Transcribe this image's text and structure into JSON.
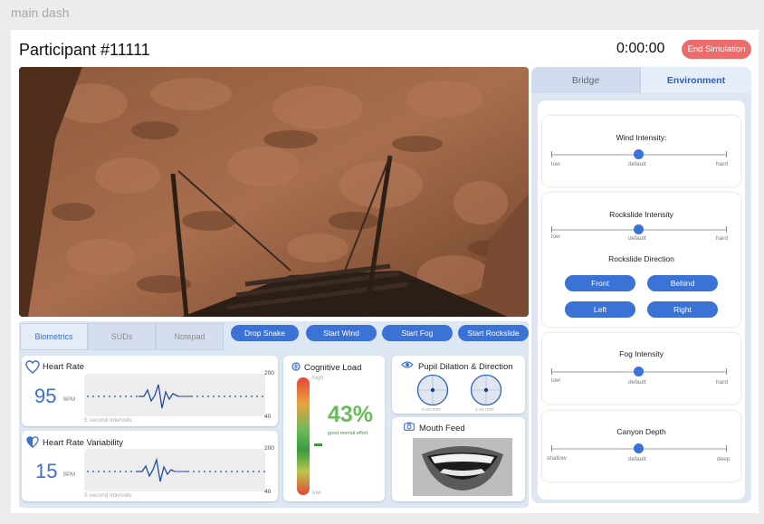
{
  "page_label": "main dash",
  "header": {
    "title": "Participant #11111",
    "timer": "0:00:00",
    "end_label": "End Simulation"
  },
  "colors": {
    "accent": "#3a72d6",
    "danger": "#ee6b6b",
    "panel": "#dde7f3",
    "success": "#6abb5a"
  },
  "video": {
    "scene": "canyon rope bridge view"
  },
  "bottom_tabs": [
    {
      "label": "Biometrics",
      "active": true
    },
    {
      "label": "SUDs",
      "active": false
    },
    {
      "label": "Notepad",
      "active": false
    }
  ],
  "actions": [
    "Drop Snake",
    "Start Wind",
    "Start Fog",
    "Start Rockslide"
  ],
  "heart_rate": {
    "title": "Heart Rate",
    "value": "95",
    "unit": "BPM",
    "scale_max": "200",
    "scale_min": "40",
    "caption": "5 second intervals",
    "icon": "heart-outline-icon"
  },
  "hrv": {
    "title": "Heart Rate Variability",
    "value": "15",
    "unit": "BPM",
    "scale_max": "200",
    "scale_min": "40",
    "caption": "5 second intervals",
    "icon": "heart-half-icon"
  },
  "cognitive_load": {
    "title": "Cognitive Load",
    "value": "43%",
    "caption": "good mental effort",
    "high_label": "high",
    "low_label": "low",
    "level_fraction": 0.43,
    "icon": "brain-icon"
  },
  "pupil": {
    "title": "Pupil Dilation & Direction",
    "left_label": "x.xx mm",
    "right_label": "x.xx mm",
    "icon": "eye-icon"
  },
  "mouth": {
    "title": "Mouth Feed",
    "icon": "camera-icon"
  },
  "right_tabs": [
    {
      "label": "Bridge",
      "active": false
    },
    {
      "label": "Environment",
      "active": true
    }
  ],
  "environment": {
    "wind": {
      "title": "Wind Intensity:",
      "min": "low",
      "mid": "default",
      "max": "hard",
      "value_fraction": 0.5
    },
    "rockslide": {
      "title": "Rockslide Intensity",
      "min": "low",
      "mid": "default",
      "max": "hard",
      "value_fraction": 0.5
    },
    "direction": {
      "title": "Rockslide Direction",
      "buttons": [
        "Front",
        "Behind",
        "Left",
        "Right"
      ]
    },
    "fog": {
      "title": "Fog Intensity",
      "min": "low",
      "mid": "default",
      "max": "hard",
      "value_fraction": 0.5
    },
    "depth": {
      "title": "Canyon Depth",
      "min": "shallow",
      "mid": "default",
      "max": "deep",
      "value_fraction": 0.5
    }
  }
}
